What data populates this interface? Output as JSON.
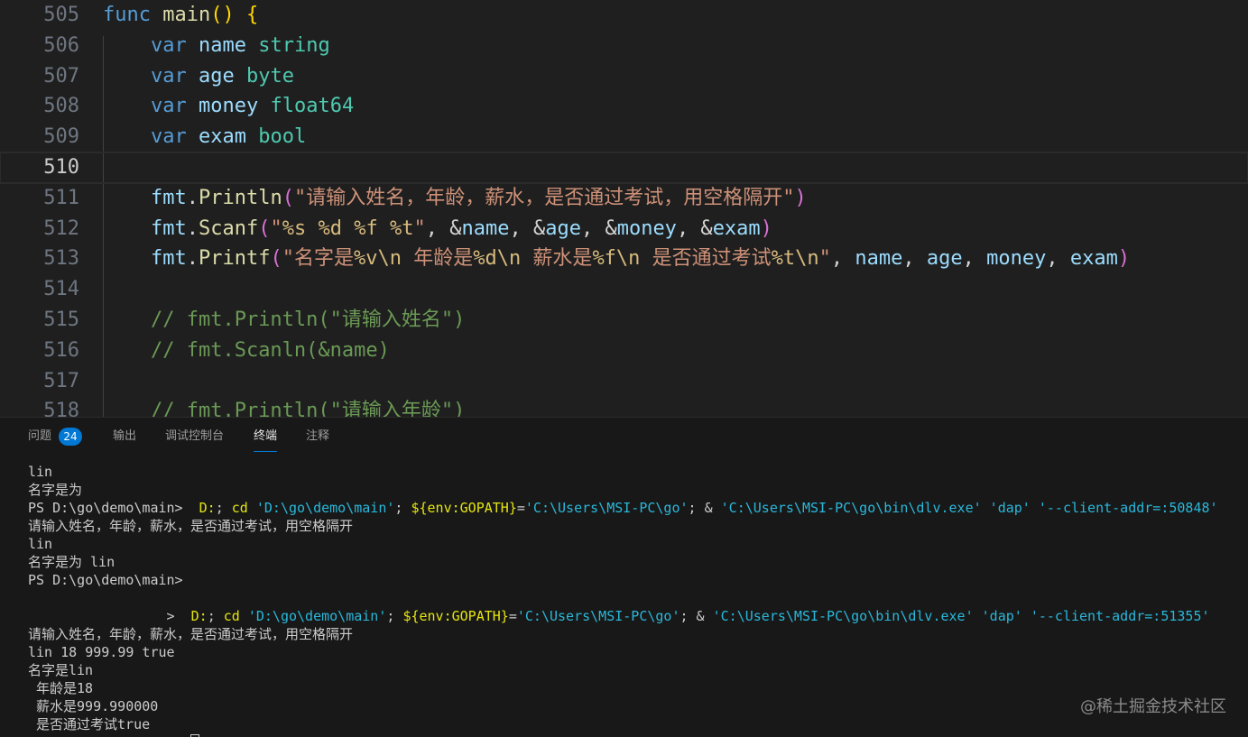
{
  "editor": {
    "lines": [
      {
        "num": "505",
        "current": false,
        "tokens": [
          [
            "k",
            "func"
          ],
          [
            "pl",
            " "
          ],
          [
            "f",
            "main"
          ],
          [
            "p1",
            "()"
          ],
          [
            "pl",
            " "
          ],
          [
            "p1",
            "{"
          ]
        ]
      },
      {
        "num": "506",
        "current": false,
        "tokens": [
          [
            "pl",
            "    "
          ],
          [
            "k",
            "var"
          ],
          [
            "pl",
            " "
          ],
          [
            "v",
            "name"
          ],
          [
            "pl",
            " "
          ],
          [
            "t",
            "string"
          ]
        ]
      },
      {
        "num": "507",
        "current": false,
        "tokens": [
          [
            "pl",
            "    "
          ],
          [
            "k",
            "var"
          ],
          [
            "pl",
            " "
          ],
          [
            "v",
            "age"
          ],
          [
            "pl",
            " "
          ],
          [
            "t",
            "byte"
          ]
        ]
      },
      {
        "num": "508",
        "current": false,
        "tokens": [
          [
            "pl",
            "    "
          ],
          [
            "k",
            "var"
          ],
          [
            "pl",
            " "
          ],
          [
            "v",
            "money"
          ],
          [
            "pl",
            " "
          ],
          [
            "t",
            "float64"
          ]
        ]
      },
      {
        "num": "509",
        "current": false,
        "tokens": [
          [
            "pl",
            "    "
          ],
          [
            "k",
            "var"
          ],
          [
            "pl",
            " "
          ],
          [
            "v",
            "exam"
          ],
          [
            "pl",
            " "
          ],
          [
            "t",
            "bool"
          ]
        ]
      },
      {
        "num": "510",
        "current": true,
        "tokens": []
      },
      {
        "num": "511",
        "current": false,
        "tokens": [
          [
            "pl",
            "    "
          ],
          [
            "v",
            "fmt"
          ],
          [
            "pl",
            "."
          ],
          [
            "f",
            "Println"
          ],
          [
            "p2",
            "("
          ],
          [
            "s",
            "\"请输入姓名，年龄，薪水，是否通过考试，用空格隔开\""
          ],
          [
            "p2",
            ")"
          ]
        ]
      },
      {
        "num": "512",
        "current": false,
        "tokens": [
          [
            "pl",
            "    "
          ],
          [
            "v",
            "fmt"
          ],
          [
            "pl",
            "."
          ],
          [
            "f",
            "Scanf"
          ],
          [
            "p2",
            "("
          ],
          [
            "s",
            "\""
          ],
          [
            "e",
            "%s"
          ],
          [
            "s",
            " "
          ],
          [
            "e",
            "%d"
          ],
          [
            "s",
            " "
          ],
          [
            "e",
            "%f"
          ],
          [
            "s",
            " "
          ],
          [
            "e",
            "%t"
          ],
          [
            "s",
            "\""
          ],
          [
            "pl",
            ", &"
          ],
          [
            "v",
            "name"
          ],
          [
            "pl",
            ", &"
          ],
          [
            "v",
            "age"
          ],
          [
            "pl",
            ", &"
          ],
          [
            "v",
            "money"
          ],
          [
            "pl",
            ", &"
          ],
          [
            "v",
            "exam"
          ],
          [
            "p2",
            ")"
          ]
        ]
      },
      {
        "num": "513",
        "current": false,
        "tokens": [
          [
            "pl",
            "    "
          ],
          [
            "v",
            "fmt"
          ],
          [
            "pl",
            "."
          ],
          [
            "f",
            "Printf"
          ],
          [
            "p2",
            "("
          ],
          [
            "s",
            "\"名字是"
          ],
          [
            "e",
            "%v\\n"
          ],
          [
            "s",
            " 年龄是"
          ],
          [
            "e",
            "%d\\n"
          ],
          [
            "s",
            " 薪水是"
          ],
          [
            "e",
            "%f\\n"
          ],
          [
            "s",
            " 是否通过考试"
          ],
          [
            "e",
            "%t\\n"
          ],
          [
            "s",
            "\""
          ],
          [
            "pl",
            ", "
          ],
          [
            "v",
            "name"
          ],
          [
            "pl",
            ", "
          ],
          [
            "v",
            "age"
          ],
          [
            "pl",
            ", "
          ],
          [
            "v",
            "money"
          ],
          [
            "pl",
            ", "
          ],
          [
            "v",
            "exam"
          ],
          [
            "p2",
            ")"
          ]
        ]
      },
      {
        "num": "514",
        "current": false,
        "tokens": []
      },
      {
        "num": "515",
        "current": false,
        "tokens": [
          [
            "pl",
            "    "
          ],
          [
            "c",
            "// fmt.Println(\"请输入姓名\")"
          ]
        ]
      },
      {
        "num": "516",
        "current": false,
        "tokens": [
          [
            "pl",
            "    "
          ],
          [
            "c",
            "// fmt.Scanln(&name)"
          ]
        ]
      },
      {
        "num": "517",
        "current": false,
        "tokens": []
      },
      {
        "num": "518",
        "current": false,
        "tokens": [
          [
            "pl",
            "    "
          ],
          [
            "c",
            "// fmt.Println(\"请输入年龄\")"
          ]
        ]
      }
    ]
  },
  "panel": {
    "tabs": [
      {
        "label": "问题",
        "badge": "24",
        "active": false
      },
      {
        "label": "输出",
        "active": false
      },
      {
        "label": "调试控制台",
        "active": false
      },
      {
        "label": "终端",
        "active": true
      },
      {
        "label": "注释",
        "active": false
      }
    ],
    "terminal_lines": [
      [
        [
          "n",
          "lin"
        ]
      ],
      [
        [
          "n",
          "名字是为"
        ]
      ],
      [
        [
          "n",
          "PS D:\\go\\demo\\main>  "
        ],
        [
          "f",
          "D:"
        ],
        [
          "n",
          "; "
        ],
        [
          "f",
          "cd"
        ],
        [
          "n",
          " "
        ],
        [
          "c",
          "'D:\\go\\demo\\main'"
        ],
        [
          "n",
          "; "
        ],
        [
          "f",
          "${env:GOPATH}"
        ],
        [
          "n",
          "="
        ],
        [
          "c",
          "'C:\\Users\\MSI-PC\\go'"
        ],
        [
          "n",
          "; & "
        ],
        [
          "c",
          "'C:\\Users\\MSI-PC\\go\\bin\\dlv.exe'"
        ],
        [
          "n",
          " "
        ],
        [
          "c",
          "'dap'"
        ],
        [
          "n",
          " "
        ],
        [
          "c",
          "'--client-addr=:50848'"
        ]
      ],
      [
        [
          "n",
          "请输入姓名，年龄，薪水，是否通过考试，用空格隔开"
        ]
      ],
      [
        [
          "n",
          "lin"
        ]
      ],
      [
        [
          "n",
          "名字是为 lin"
        ]
      ],
      [
        [
          "n",
          "PS D:\\go\\demo\\main>"
        ]
      ],
      [],
      [
        [
          "n",
          "                 >  "
        ],
        [
          "f",
          "D:"
        ],
        [
          "n",
          "; "
        ],
        [
          "f",
          "cd"
        ],
        [
          "n",
          " "
        ],
        [
          "c",
          "'D:\\go\\demo\\main'"
        ],
        [
          "n",
          "; "
        ],
        [
          "f",
          "${env:GOPATH}"
        ],
        [
          "n",
          "="
        ],
        [
          "c",
          "'C:\\Users\\MSI-PC\\go'"
        ],
        [
          "n",
          "; & "
        ],
        [
          "c",
          "'C:\\Users\\MSI-PC\\go\\bin\\dlv.exe'"
        ],
        [
          "n",
          " "
        ],
        [
          "c",
          "'dap'"
        ],
        [
          "n",
          " "
        ],
        [
          "c",
          "'--client-addr=:51355'"
        ]
      ],
      [
        [
          "n",
          "请输入姓名，年龄，薪水，是否通过考试，用空格隔开"
        ]
      ],
      [
        [
          "n",
          "lin 18 999.99 true"
        ]
      ],
      [
        [
          "n",
          "名字是lin"
        ]
      ],
      [
        [
          "n",
          " 年龄是18"
        ]
      ],
      [
        [
          "n",
          " 薪水是999.990000"
        ]
      ],
      [
        [
          "n",
          " 是否通过考试true"
        ]
      ]
    ]
  },
  "watermark": "@稀土掘金技术社区"
}
